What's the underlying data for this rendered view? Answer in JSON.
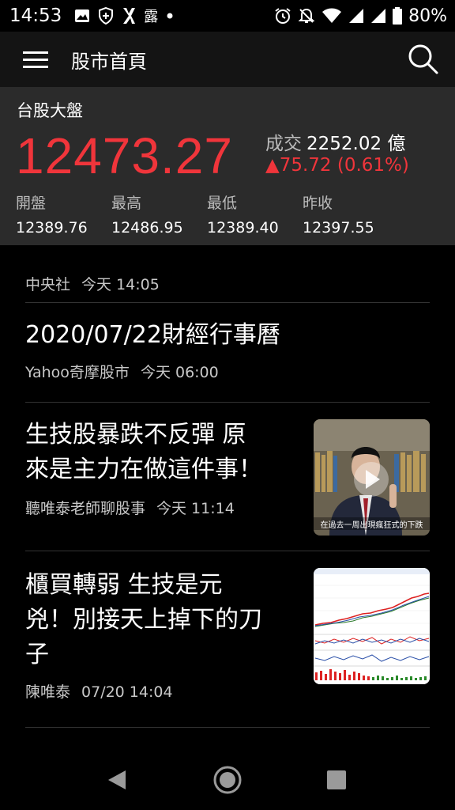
{
  "status_bar": {
    "time": "14:53",
    "left_icons": [
      "image-icon",
      "shield-icon",
      "app-x-icon",
      "lu-icon",
      "dot-icon"
    ],
    "lu_char": "露",
    "battery": "80%",
    "right_icons": [
      "alarm-icon",
      "mute-icon",
      "wifi-icon",
      "signal-icon",
      "signal-icon",
      "battery-icon"
    ]
  },
  "app_bar": {
    "title": "股市首頁",
    "menu_icon": "hamburger-menu-icon",
    "search_icon": "search-icon"
  },
  "index": {
    "name": "台股大盤",
    "value": "12473.27",
    "volume_label": "成交",
    "volume_value": "2252.02 億",
    "change": "▲75.72 (0.61%)",
    "color_up": "#f0353b",
    "stats": [
      {
        "label": "開盤",
        "value": "12389.76"
      },
      {
        "label": "最高",
        "value": "12486.95"
      },
      {
        "label": "最低",
        "value": "12389.40"
      },
      {
        "label": "昨收",
        "value": "12397.55"
      }
    ]
  },
  "news": [
    {
      "title": "",
      "source": "中央社",
      "time": "今天 14:05"
    },
    {
      "title": "2020/07/22財經行事曆",
      "source": "Yahoo奇摩股市",
      "time": "今天 06:00"
    },
    {
      "title_lines": [
        "生技股暴跌不反彈 原",
        "來是主力在做這件事！"
      ],
      "source": "聽唯泰老師聊股事",
      "time": "今天 11:14",
      "thumb": "video",
      "thumb_caption": "在過去一周出現瘋狂式的下跌"
    },
    {
      "title_lines": [
        "櫃買轉弱 生技是元",
        "兇！別接天上掉下的刀",
        "子"
      ],
      "source": "陳唯泰",
      "time": "07/20 14:04",
      "thumb": "chart"
    }
  ],
  "nav_bar": {
    "back_icon": "back-triangle-icon",
    "home_icon": "home-circle-icon",
    "recents_icon": "recents-square-icon"
  }
}
